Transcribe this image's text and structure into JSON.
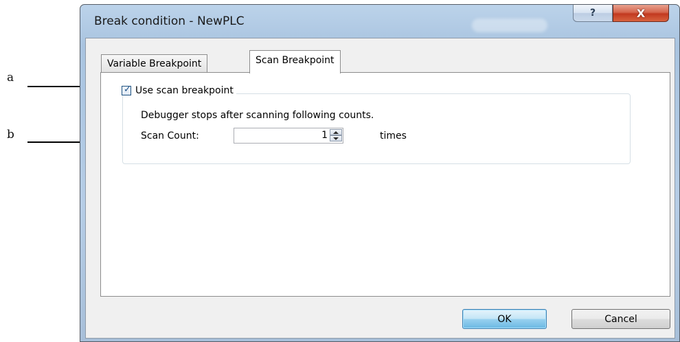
{
  "callouts": {
    "a": "a",
    "b": "b"
  },
  "window": {
    "title": "Break condition - NewPLC",
    "help_glyph": "?",
    "close_glyph": "X"
  },
  "tabs": [
    {
      "label": "Variable Breakpoint",
      "active": false
    },
    {
      "label": "Scan Breakpoint",
      "active": true
    }
  ],
  "scan": {
    "checkbox_label": "Use scan breakpoint",
    "checked": true,
    "description": "Debugger stops after scanning following counts.",
    "count_label": "Scan Count:",
    "count_value": "1",
    "unit": "times"
  },
  "buttons": {
    "ok": "OK",
    "cancel": "Cancel"
  },
  "colors": {
    "title_bar": "#b6cde6",
    "close_button": "#c2391f",
    "ok_button": "#98d1ef"
  }
}
